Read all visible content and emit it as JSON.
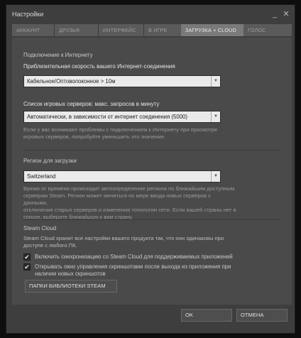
{
  "window": {
    "title": "Настройки",
    "minimize_glyph": "_",
    "close_glyph": "✕"
  },
  "tabs": [
    {
      "label": "АККАУНТ"
    },
    {
      "label": "ДРУЗЬЯ"
    },
    {
      "label": "ИНТЕРФЕЙС"
    },
    {
      "label": "В ИГРЕ"
    },
    {
      "label": "ЗАГРУЗКА + CLOUD",
      "active": true
    },
    {
      "label": "ГОЛОС"
    }
  ],
  "internet": {
    "section_title": "Подключение к Интернету",
    "speed_label": "Приблизительная скорость вашего Интернет-соединения",
    "speed_value": "Кабельное/Оптоволоконное > 10м"
  },
  "servers": {
    "label": "Список игровых серверов: макс. запросов в минуту",
    "value": "Автоматически, в зависимости от интернет соединения (5000)",
    "hint_1": "Если у вас возникают проблемы с подключением к Интернету при просмотре",
    "hint_2": "игровых серверов, попробуйте уменьшить это значение."
  },
  "region": {
    "section_title": "Регион для загрузки",
    "value": "Switzerland",
    "hint_1": "Время от времени происходит автоопределение региона по ближайшим доступным",
    "hint_2": "серверам Steam. Регион может меняться по мере ввода новых серверов с данными,",
    "hint_3": "отключения старых серверов и изменения топологии сети. Если вашей страны нет в",
    "hint_4": "списке, выберите ближайшую к вам страну."
  },
  "cloud": {
    "section_title": "Steam Cloud",
    "desc_1": "Steam Cloud хранит все настройки вашего продукта так, что они одинаковы при",
    "desc_2": "доступе с любого ПК.",
    "sync_label": "Включить синхронизацию со Steam Cloud для поддерживаемых приложений",
    "screenshot_label_1": "Открывать окно управления скриншотами после выхода из приложения при",
    "screenshot_label_2": "наличии новых скриншотов",
    "check_glyph": "✔"
  },
  "library_button": "ПАПКИ БИБЛИОТЕКИ STEAM",
  "footer": {
    "ok": "OK",
    "cancel": "ОТМЕНА"
  },
  "icons": {
    "dropdown": "▼"
  },
  "colors": {
    "window_bg": "#3e3e3e",
    "panel_bg": "#4a4a4a",
    "active_tab": "#7a7a7a",
    "select_bg": "#eaeaea"
  }
}
